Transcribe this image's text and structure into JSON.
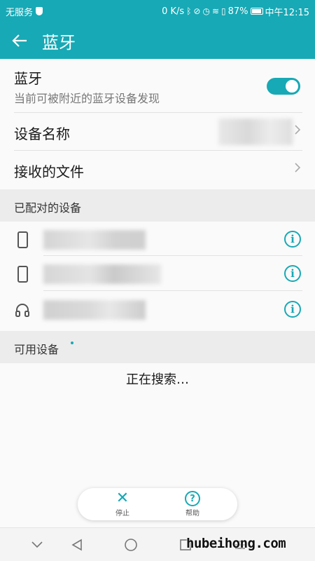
{
  "statusbar": {
    "carrier": "无服务",
    "speed": "0 K/s",
    "battery": "87%",
    "time": "中午12:15"
  },
  "header": {
    "title": "蓝牙"
  },
  "bluetooth": {
    "label": "蓝牙",
    "subtitle": "当前可被附近的蓝牙设备发现",
    "enabled": true
  },
  "device_name": {
    "label": "设备名称"
  },
  "received_files": {
    "label": "接收的文件"
  },
  "paired": {
    "header": "已配对的设备",
    "devices": [
      {
        "type": "phone-icon"
      },
      {
        "type": "phone-icon"
      },
      {
        "type": "headset-icon"
      }
    ]
  },
  "available": {
    "header": "可用设备",
    "status": "正在搜索…"
  },
  "actions": {
    "stop": "停止",
    "help": "帮助"
  },
  "watermark": "hubeihong.com",
  "colors": {
    "accent": "#17a9b5"
  }
}
